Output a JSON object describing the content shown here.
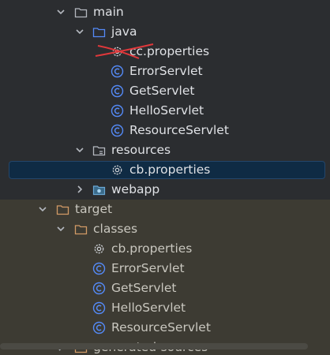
{
  "tree": {
    "rows": [
      {
        "label": "main",
        "icon": "folder-icon"
      },
      {
        "label": "java",
        "icon": "source-folder-icon"
      },
      {
        "label": "cc.properties",
        "icon": "gear-icon"
      },
      {
        "label": "ErrorServlet",
        "icon": "class-icon"
      },
      {
        "label": "GetServlet",
        "icon": "class-icon"
      },
      {
        "label": "HelloServlet",
        "icon": "class-icon"
      },
      {
        "label": "ResourceServlet",
        "icon": "class-icon"
      },
      {
        "label": "resources",
        "icon": "resources-folder-icon"
      },
      {
        "label": "cb.properties",
        "icon": "gear-icon"
      },
      {
        "label": "webapp",
        "icon": "web-folder-icon"
      },
      {
        "label": "target",
        "icon": "excluded-folder-icon"
      },
      {
        "label": "classes",
        "icon": "excluded-folder-icon"
      },
      {
        "label": "cb.properties",
        "icon": "gear-icon"
      },
      {
        "label": "ErrorServlet",
        "icon": "class-icon"
      },
      {
        "label": "GetServlet",
        "icon": "class-icon"
      },
      {
        "label": "HelloServlet",
        "icon": "class-icon"
      },
      {
        "label": "ResourceServlet",
        "icon": "class-icon"
      },
      {
        "label": "generated-sources",
        "icon": "excluded-folder-icon"
      }
    ]
  },
  "colors": {
    "background": "#2b2d30",
    "excluded_background": "#3d3b33",
    "selection": "#0f2b44",
    "class_icon": "#548af7",
    "excluded_folder": "#d19a66",
    "strike_mark": "#e0383b"
  }
}
